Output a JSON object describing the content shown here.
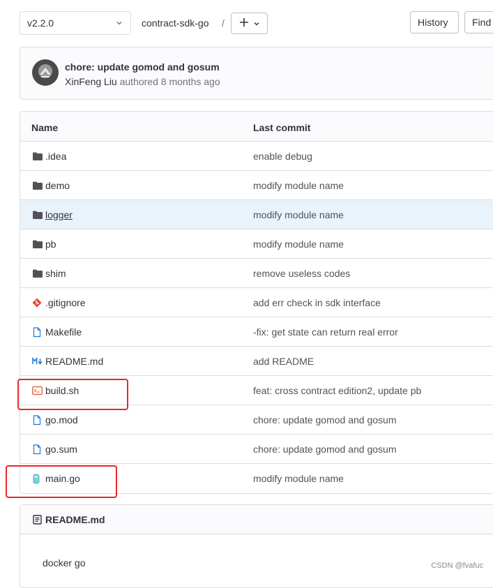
{
  "toolbar": {
    "branch": "v2.2.0",
    "repo": "contract-sdk-go",
    "separator": "/",
    "history_label": "History",
    "find_label": "Find"
  },
  "commit": {
    "title": "chore: update gomod and gosum",
    "author": "XinFeng Liu",
    "meta": "authored 8 months ago"
  },
  "table": {
    "header_name": "Name",
    "header_commit": "Last commit",
    "rows": [
      {
        "name": "",
        "icon": "folder-icon",
        "commit": ""
      },
      {
        "name": ".idea",
        "icon": "folder-icon",
        "commit": "enable debug"
      },
      {
        "name": "demo",
        "icon": "folder-icon",
        "commit": "modify module name"
      },
      {
        "name": "logger",
        "icon": "folder-icon",
        "commit": "modify module name"
      },
      {
        "name": "pb",
        "icon": "folder-icon",
        "commit": "modify module name"
      },
      {
        "name": "shim",
        "icon": "folder-icon",
        "commit": "remove useless codes"
      },
      {
        "name": ".gitignore",
        "icon": "git-icon",
        "commit": "add err check in sdk interface"
      },
      {
        "name": "Makefile",
        "icon": "file-icon",
        "commit": "-fix: get state can return real error"
      },
      {
        "name": "README.md",
        "icon": "markdown-icon",
        "commit": "add README"
      },
      {
        "name": "build.sh",
        "icon": "terminal-icon",
        "commit": "feat: cross contract edition2, update pb"
      },
      {
        "name": "go.mod",
        "icon": "file-icon",
        "commit": "chore: update gomod and gosum"
      },
      {
        "name": "go.sum",
        "icon": "file-icon",
        "commit": "chore: update gomod and gosum"
      },
      {
        "name": "main.go",
        "icon": "go-gopher-icon",
        "commit": "modify module name"
      }
    ]
  },
  "readme": {
    "title": "README.md",
    "content": "docker go"
  },
  "watermark": "CSDN @fvafuc",
  "colors": {
    "hover_row": "#e9f3fc",
    "annotation": "#e8282b",
    "git_icon": "#e24329",
    "markdown_icon": "#1f78d1",
    "terminal_icon": "#e0562d"
  }
}
